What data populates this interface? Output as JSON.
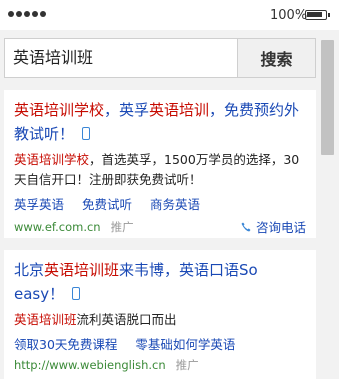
{
  "status": {
    "battery_text": "100%"
  },
  "search": {
    "query": "英语培训班",
    "button_label": "搜索"
  },
  "results": [
    {
      "title_parts": [
        {
          "text": "英语培训学校",
          "hl": true
        },
        {
          "text": "，英孚",
          "hl": false
        },
        {
          "text": "英语培训",
          "hl": true
        },
        {
          "text": "，免费预约外教试听！",
          "hl": false
        }
      ],
      "desc_parts": [
        {
          "text": "英语培训学校",
          "hl": true
        },
        {
          "text": "，首选英孚，1500万学员的选择，30天自信开口！注册即获免费试听！",
          "hl": false
        }
      ],
      "sitelinks": [
        "英孚英语",
        "免费试听",
        "商务英语"
      ],
      "url": "www.ef.com.cn",
      "ad_label": "推广",
      "call_label": "咨询电话"
    },
    {
      "title_parts": [
        {
          "text": "北京",
          "hl": false
        },
        {
          "text": "英语培训班",
          "hl": true
        },
        {
          "text": "来韦博，英语口语So easy！",
          "hl": false
        }
      ],
      "desc_parts": [
        {
          "text": "英语培训班",
          "hl": true
        },
        {
          "text": "流利英语脱口而出",
          "hl": false
        }
      ],
      "sitelinks": [
        "领取30天免费课程",
        "零基础如何学英语"
      ],
      "url": "http://www.webienglish.cn",
      "ad_label": "推广"
    }
  ],
  "colors": {
    "highlight": "#c60a00",
    "link": "#1a49b5",
    "url": "#3b8a38"
  }
}
